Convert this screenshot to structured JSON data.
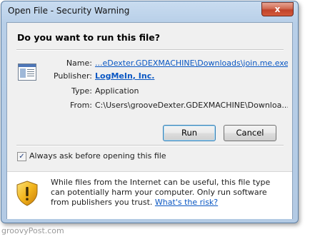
{
  "window": {
    "title": "Open File - Security Warning",
    "close_glyph": "x"
  },
  "dialog": {
    "question": "Do you want to run this file?",
    "fields": {
      "name_label": "Name:",
      "name_value": "...eDexter.GDEXMACHINE\\Downloads\\join.me.exe",
      "publisher_label": "Publisher:",
      "publisher_value": "LogMeIn, Inc.",
      "type_label": "Type:",
      "type_value": "Application",
      "from_label": "From:",
      "from_value": "C:\\Users\\grooveDexter.GDEXMACHINE\\Downloa..."
    },
    "buttons": {
      "run": "Run",
      "cancel": "Cancel"
    },
    "checkbox": {
      "checked": true,
      "label": "Always ask before opening this file"
    },
    "warning": {
      "text": "While files from the Internet can be useful, this file type can potentially harm your computer. Only run software from publishers you trust.",
      "link": "What's the risk?"
    }
  },
  "watermark": "groovyPost.com",
  "colors": {
    "link": "#0a57c3",
    "titlebar": "#c9dcf0",
    "close": "#c0432b"
  },
  "icons": [
    "file-icon",
    "close-icon",
    "checkmark-icon",
    "shield-warning-icon"
  ]
}
